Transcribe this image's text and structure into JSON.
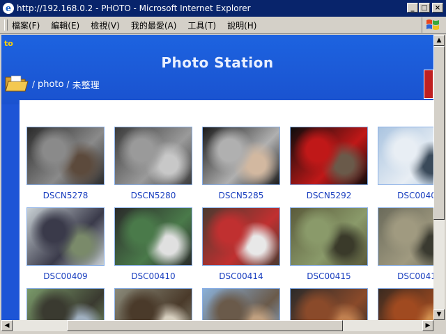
{
  "window": {
    "title": "http://192.168.0.2 - PHOTO - Microsoft Internet Explorer",
    "buttons": {
      "minimize": "_",
      "maximize": "□",
      "close": "×"
    }
  },
  "menu": [
    "檔案(F)",
    "編輯(E)",
    "檢視(V)",
    "我的最愛(A)",
    "工具(T)",
    "說明(H)"
  ],
  "page": {
    "corner_text": "to",
    "heading": "Photo Station",
    "breadcrumb": {
      "sep1": "/",
      "photo": "photo",
      "sep2": "/",
      "current": "未整理"
    }
  },
  "photos": [
    {
      "caption": "DSCN5278",
      "palette": [
        "#2a2a2a",
        "#8a8a8a",
        "#5c4a3c"
      ]
    },
    {
      "caption": "DSCN5280",
      "palette": [
        "#3a3a3a",
        "#9a9a9a",
        "#c8c8c8"
      ]
    },
    {
      "caption": "DSCN5285",
      "palette": [
        "#1a1a1a",
        "#b0b0b0",
        "#d2b8a0"
      ]
    },
    {
      "caption": "DSCN5292",
      "palette": [
        "#0c0c0c",
        "#c01818",
        "#6a5a4a"
      ]
    },
    {
      "caption": "DSC0040",
      "palette": [
        "#aac4e0",
        "#e8eef4",
        "#3a4a5a"
      ]
    },
    {
      "caption": "DSC00409",
      "palette": [
        "#c8d0d4",
        "#3a3a4a",
        "#7a8a6a"
      ]
    },
    {
      "caption": "DSC00410",
      "palette": [
        "#2a2a2a",
        "#4a7a4a",
        "#e0e0e0"
      ]
    },
    {
      "caption": "DSC00414",
      "palette": [
        "#4a3a30",
        "#c03030",
        "#e8e8e8"
      ]
    },
    {
      "caption": "DSC00415",
      "palette": [
        "#5a5a3a",
        "#8a9a6a",
        "#3a3a2a"
      ]
    },
    {
      "caption": "DSC0041",
      "palette": [
        "#6a6a5a",
        "#a09a80",
        "#3a3a30"
      ]
    },
    {
      "caption": "",
      "palette": [
        "#7a9a6a",
        "#3a3a30",
        "#a0b0c0"
      ]
    },
    {
      "caption": "",
      "palette": [
        "#8a8a7a",
        "#4a3a2a",
        "#d8d0c0"
      ]
    },
    {
      "caption": "",
      "palette": [
        "#8ab0d8",
        "#6a5a4a",
        "#c0a080"
      ]
    },
    {
      "caption": "",
      "palette": [
        "#2a2a2a",
        "#8a4a2a",
        "#c08050"
      ]
    },
    {
      "caption": "",
      "palette": [
        "#3a2a20",
        "#a04a20",
        "#d09050"
      ]
    }
  ],
  "colors": {
    "titlebar": "#08246b",
    "page_bg": "#1d55d6",
    "caption": "#1a3fbf"
  }
}
